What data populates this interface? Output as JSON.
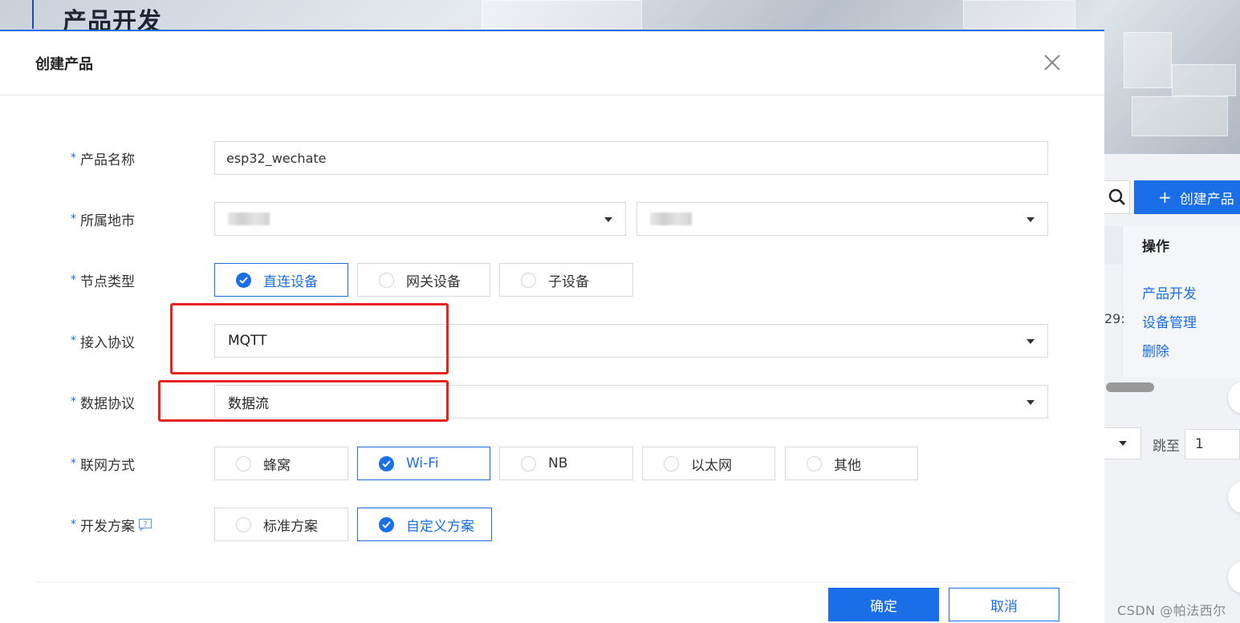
{
  "background": {
    "page_title": "产品开发",
    "create_button_label": "创建产品",
    "table_header_op": "操作",
    "row_links": [
      "产品开发",
      "设备管理",
      "删除"
    ],
    "row_fragment": "29:",
    "jump_label": "跳至",
    "jump_value": "1"
  },
  "dialog": {
    "title": "创建产品",
    "fields": {
      "name": {
        "label": "产品名称",
        "value": "esp32_wechate"
      },
      "region": {
        "label": "所属地市"
      },
      "node_type": {
        "label": "节点类型",
        "options": [
          "直连设备",
          "网关设备",
          "子设备"
        ],
        "selected": "直连设备"
      },
      "access_protocol": {
        "label": "接入协议",
        "value": "MQTT"
      },
      "data_protocol": {
        "label": "数据协议",
        "value": "数据流"
      },
      "network": {
        "label": "联网方式",
        "options": [
          "蜂窝",
          "Wi-Fi",
          "NB",
          "以太网",
          "其他"
        ],
        "selected": "Wi-Fi"
      },
      "dev_plan": {
        "label": "开发方案",
        "options": [
          "标准方案",
          "自定义方案"
        ],
        "selected": "自定义方案"
      }
    },
    "confirm_label": "确定",
    "cancel_label": "取消"
  },
  "watermark": "CSDN @帕法西尔",
  "colors": {
    "accent": "#1a6fe8",
    "annotation": "#e8221c"
  }
}
